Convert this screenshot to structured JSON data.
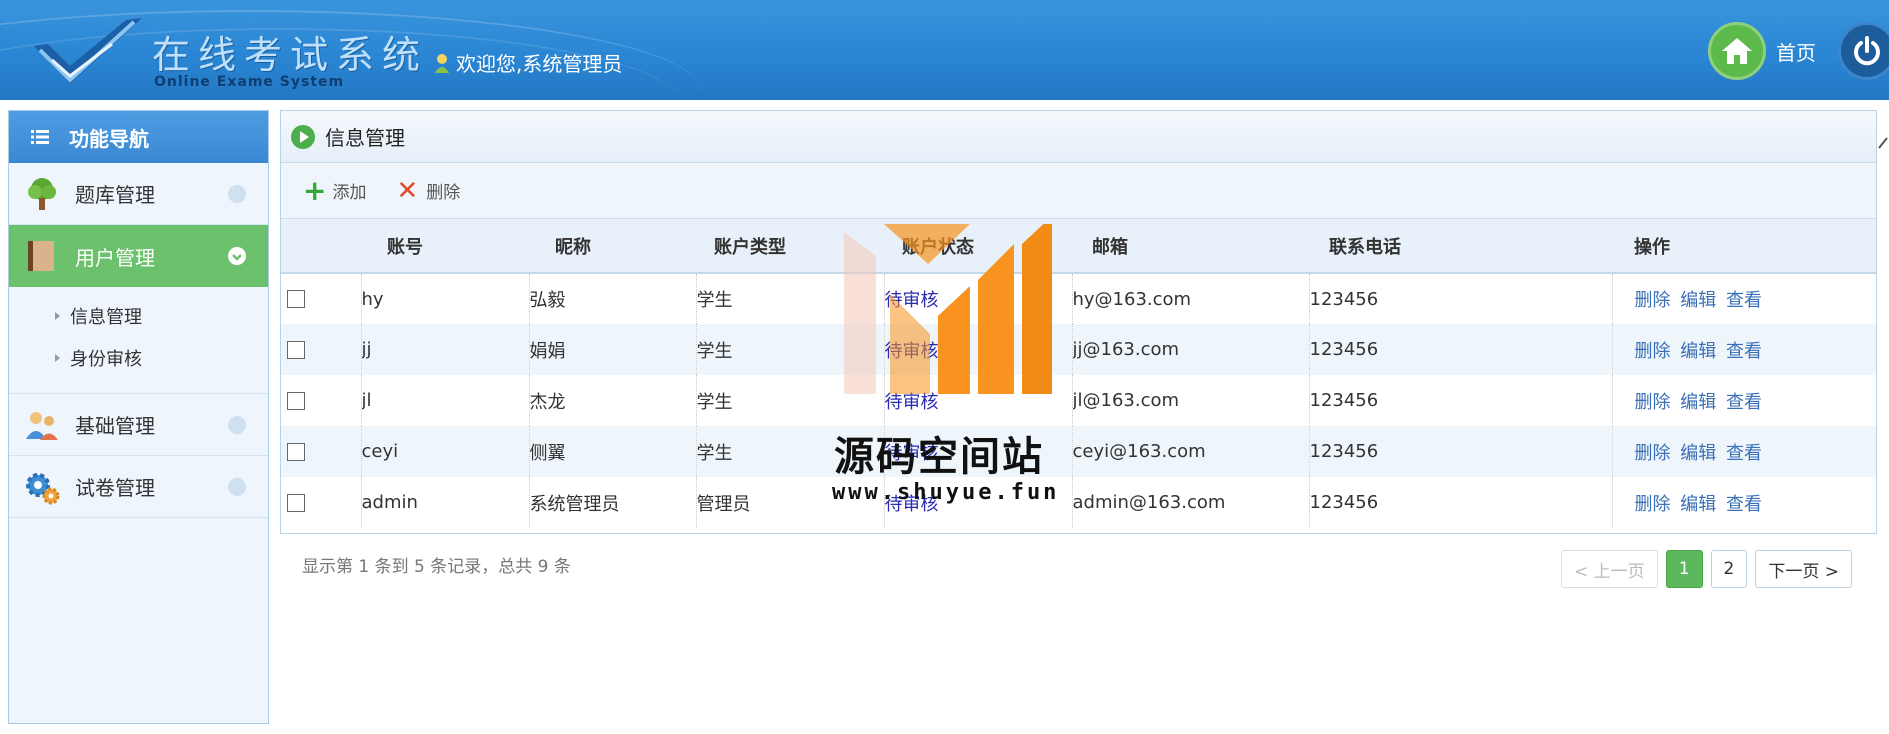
{
  "header": {
    "logo_cn": "在线考试系统",
    "logo_en": "Online Exame System",
    "welcome": "欢迎您,系统管理员",
    "home_label": "首页"
  },
  "sidebar": {
    "title": "功能导航",
    "items": [
      {
        "label": "题库管理",
        "icon": "tree-icon"
      },
      {
        "label": "用户管理",
        "icon": "book-icon",
        "active": true
      },
      {
        "label": "基础管理",
        "icon": "users-icon"
      },
      {
        "label": "试卷管理",
        "icon": "gear-icon"
      }
    ],
    "subitems": [
      "信息管理",
      "身份审核"
    ]
  },
  "panel": {
    "title": "信息管理",
    "toolbar": {
      "add_label": "添加",
      "delete_label": "删除"
    },
    "columns": [
      "账号",
      "昵称",
      "账户类型",
      "账户状态",
      "邮箱",
      "联系电话",
      "操作"
    ],
    "rows": [
      {
        "account": "hy",
        "nickname": "弘毅",
        "type": "学生",
        "status": "待审核",
        "email": "hy@163.com",
        "phone": "123456"
      },
      {
        "account": "jj",
        "nickname": "娟娟",
        "type": "学生",
        "status": "待审核",
        "email": "jj@163.com",
        "phone": "123456"
      },
      {
        "account": "jl",
        "nickname": "杰龙",
        "type": "学生",
        "status": "待审核",
        "email": "jl@163.com",
        "phone": "123456"
      },
      {
        "account": "ceyi",
        "nickname": "侧翼",
        "type": "学生",
        "status": "待审核",
        "email": "ceyi@163.com",
        "phone": "123456"
      },
      {
        "account": "admin",
        "nickname": "系统管理员",
        "type": "管理员",
        "status": "待审核",
        "email": "admin@163.com",
        "phone": "123456"
      }
    ],
    "ops": {
      "delete": "删除",
      "edit": "编辑",
      "view": "查看"
    }
  },
  "pager": {
    "info": "显示第 1 条到 5 条记录，总共 9 条",
    "prev": "< 上一页",
    "pages": [
      "1",
      "2"
    ],
    "current": "1",
    "next": "下一页 >"
  },
  "watermark": {
    "text": "源码空间站",
    "url": "www.shuyue.fun"
  },
  "colors": {
    "header_blue": "#2a86d4",
    "active_green": "#6cc16c",
    "link_blue": "#3a70b8",
    "watermark_orange": "#f7931e"
  }
}
